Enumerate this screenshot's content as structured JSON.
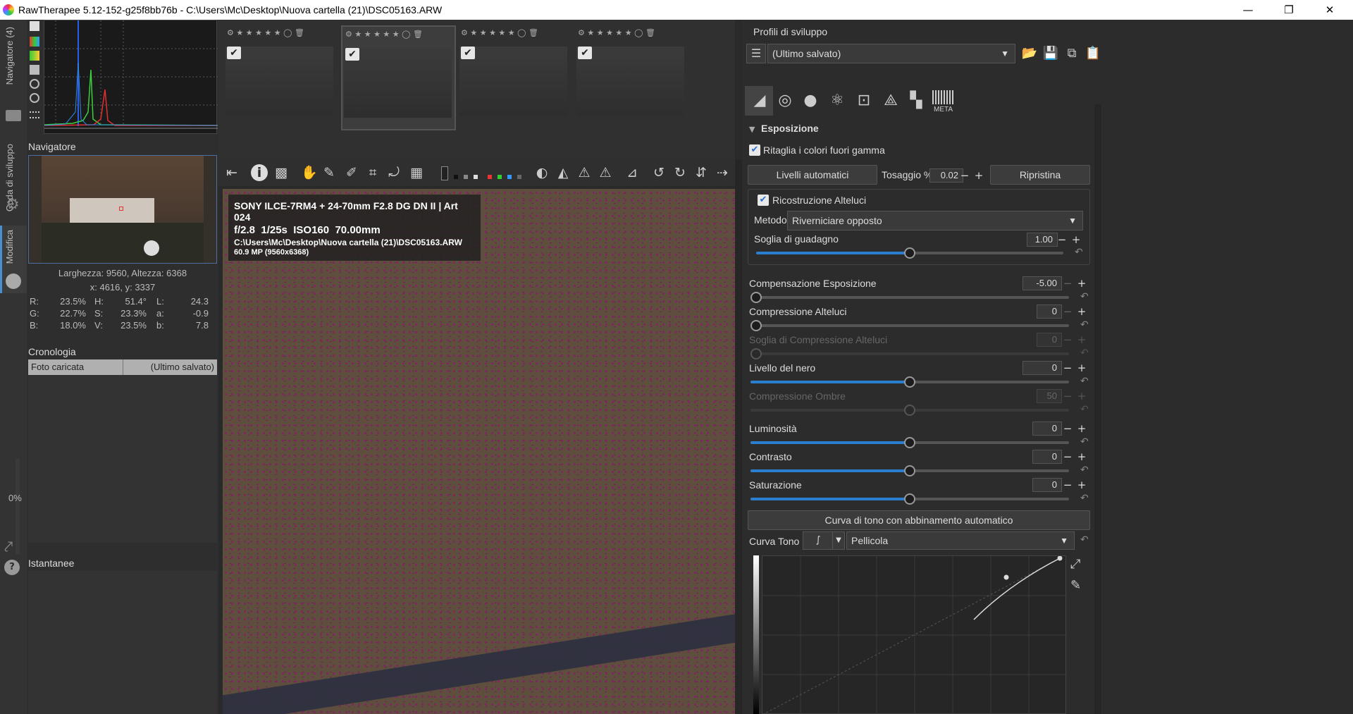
{
  "window": {
    "title": "RawTherapee 5.12-152-g25f8bb76b - C:\\Users\\Mc\\Desktop\\Nuova cartella (21)\\DSC05163.ARW",
    "min": "—",
    "max": "❐",
    "close": "✕"
  },
  "vtabs": {
    "navigator": "Navigatore (4)",
    "queue": "Coda di sviluppo",
    "edit": "Modifica",
    "zoom": "0%"
  },
  "navigator": {
    "header": "Navigatore",
    "size": "Larghezza: 9560, Altezza: 6368",
    "coords": "x: 4616, y: 3337",
    "rows": [
      {
        "k1": "R:",
        "v1": "23.5%",
        "k2": "H:",
        "v2": "51.4°",
        "k3": "L:",
        "v3": "24.3"
      },
      {
        "k1": "G:",
        "v1": "22.7%",
        "k2": "S:",
        "v2": "23.3%",
        "k3": "a:",
        "v3": "-0.9"
      },
      {
        "k1": "B:",
        "v1": "18.0%",
        "k2": "V:",
        "v2": "23.5%",
        "k3": "b:",
        "v3": "7.8"
      }
    ]
  },
  "history": {
    "header": "Cronologia",
    "col1": "Foto caricata",
    "col2": "(Ultimo salvato)"
  },
  "snapshots": {
    "header": "Istantanee"
  },
  "overlay": {
    "line1": "SONY ILCE-7RM4 + 24-70mm F2.8 DG DN II | Art 024",
    "line2_f": "f/2.8",
    "line2_s": "1/25s",
    "line2_iso": "ISO160",
    "line2_mm": "70.00mm",
    "line3": "C:\\Users\\Mc\\Desktop\\Nuova cartella (21)\\DSC05163.ARW",
    "line4": "60.9 MP (9560x6368)"
  },
  "profiles": {
    "header": "Profili di sviluppo",
    "selected": "(Ultimo salvato)"
  },
  "toolTabs": {
    "meta": "META"
  },
  "exposure": {
    "header": "Esposizione",
    "clip_label": "Ritaglia i colori fuori gamma",
    "auto_levels": "Livelli automatici",
    "clip_pct_label": "Tosaggio %",
    "clip_pct_value": "0.02",
    "reset": "Ripristina",
    "hl_recon_label": "Ricostruzione Alteluci",
    "method_label": "Metodo:",
    "method_value": "Riverniciare opposto",
    "gain_label": "Soglia di guadagno",
    "gain_value": "1.00",
    "sliders": [
      {
        "label": "Compensazione Esposizione",
        "value": "-5.00"
      },
      {
        "label": "Compressione Alteluci",
        "value": "0"
      },
      {
        "label": "Soglia di Compressione Alteluci",
        "value": "0"
      },
      {
        "label": "Livello del nero",
        "value": "0"
      },
      {
        "label": "Compressione Ombre",
        "value": "50"
      },
      {
        "label": "Luminosità",
        "value": "0"
      },
      {
        "label": "Contrasto",
        "value": "0"
      },
      {
        "label": "Saturazione",
        "value": "0"
      }
    ],
    "auto_curve": "Curva di tono con abbinamento automatico",
    "curve_label": "Curva Tono 1:",
    "curve_type": "Pellicola"
  }
}
